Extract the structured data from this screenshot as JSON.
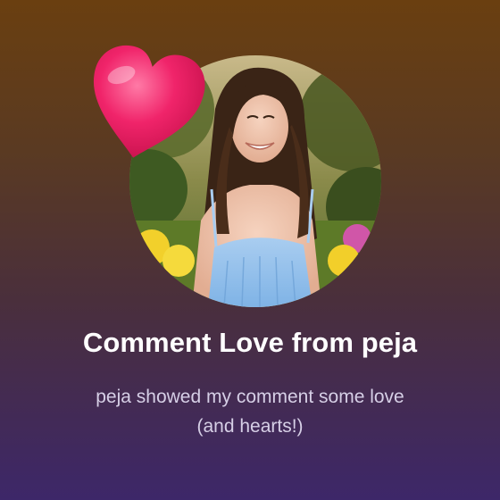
{
  "notification": {
    "title": "Comment Love from peja",
    "message_line1": "peja showed my comment some love",
    "message_line2": "(and hearts!)",
    "icon": "heart-icon",
    "avatar": "profile-photo"
  },
  "colors": {
    "heart": "#e8175d",
    "title": "#ffffff",
    "message": "#d6cfe6",
    "background_top": "#6a3f10",
    "background_bottom": "#3d2769"
  }
}
